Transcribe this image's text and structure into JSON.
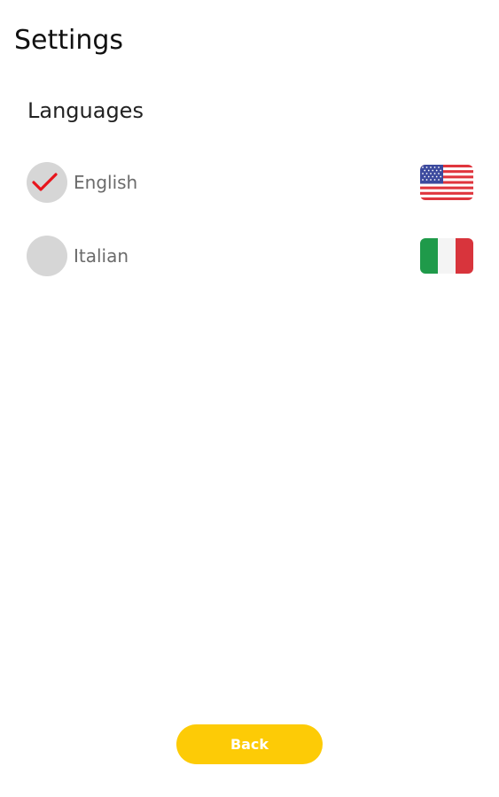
{
  "header": {
    "title": "Settings"
  },
  "languages": {
    "section_title": "Languages",
    "items": [
      {
        "label": "English",
        "selected": true,
        "flag": "us-flag-icon"
      },
      {
        "label": "Italian",
        "selected": false,
        "flag": "italy-flag-icon"
      }
    ]
  },
  "footer": {
    "back_label": "Back"
  },
  "colors": {
    "accent": "#fdcb06",
    "check": "#e8141c",
    "radio_bg": "#d6d6d6"
  }
}
